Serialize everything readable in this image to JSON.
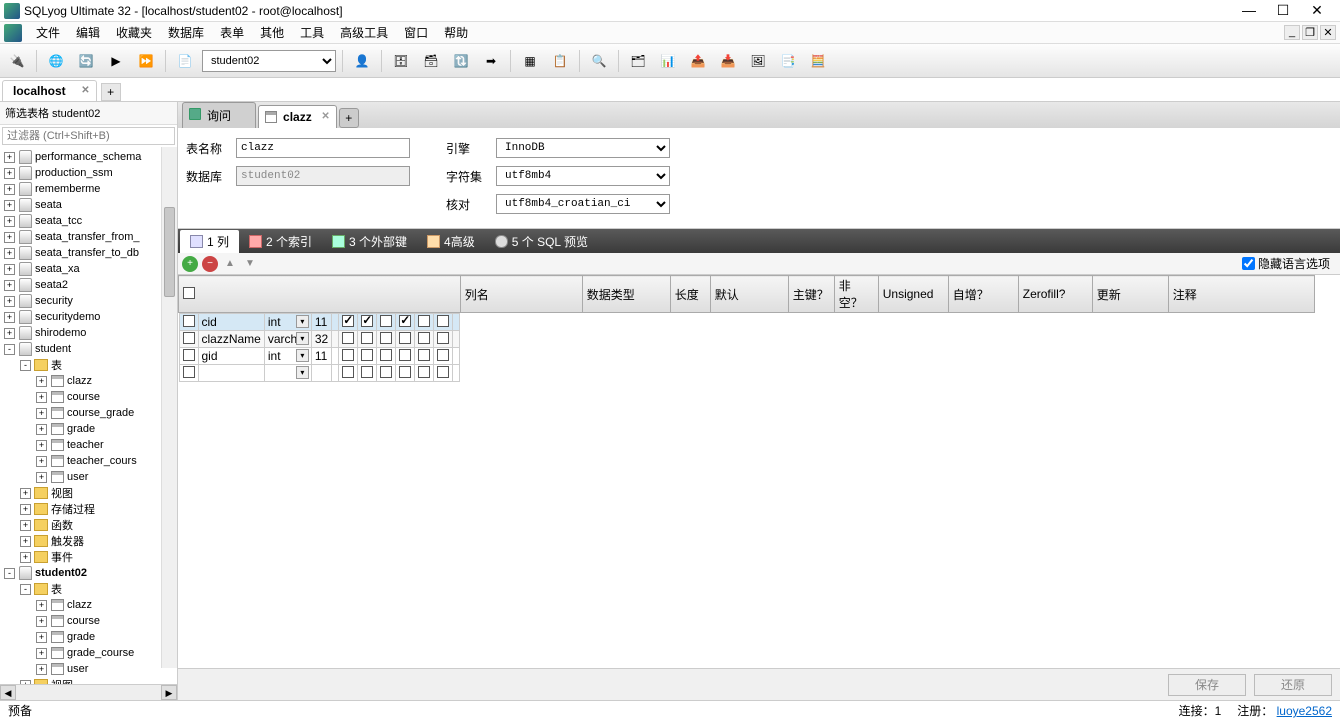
{
  "title": "SQLyog Ultimate 32 - [localhost/student02 - root@localhost]",
  "menu": [
    "文件",
    "编辑",
    "收藏夹",
    "数据库",
    "表单",
    "其他",
    "工具",
    "高级工具",
    "窗口",
    "帮助"
  ],
  "db_dropdown": "student02",
  "conn_tab": "localhost",
  "sidebar": {
    "filter_header": "筛选表格 student02",
    "filter_placeholder": "过滤器 (Ctrl+Shift+B)",
    "items": [
      {
        "indent": 0,
        "toggle": "+",
        "icon": "db",
        "label": "performance_schema"
      },
      {
        "indent": 0,
        "toggle": "+",
        "icon": "db",
        "label": "production_ssm"
      },
      {
        "indent": 0,
        "toggle": "+",
        "icon": "db",
        "label": "rememberme"
      },
      {
        "indent": 0,
        "toggle": "+",
        "icon": "db",
        "label": "seata"
      },
      {
        "indent": 0,
        "toggle": "+",
        "icon": "db",
        "label": "seata_tcc"
      },
      {
        "indent": 0,
        "toggle": "+",
        "icon": "db",
        "label": "seata_transfer_from_"
      },
      {
        "indent": 0,
        "toggle": "+",
        "icon": "db",
        "label": "seata_transfer_to_db"
      },
      {
        "indent": 0,
        "toggle": "+",
        "icon": "db",
        "label": "seata_xa"
      },
      {
        "indent": 0,
        "toggle": "+",
        "icon": "db",
        "label": "seata2"
      },
      {
        "indent": 0,
        "toggle": "+",
        "icon": "db",
        "label": "security"
      },
      {
        "indent": 0,
        "toggle": "+",
        "icon": "db",
        "label": "securitydemo"
      },
      {
        "indent": 0,
        "toggle": "+",
        "icon": "db",
        "label": "shirodemo"
      },
      {
        "indent": 0,
        "toggle": "-",
        "icon": "db",
        "label": "student"
      },
      {
        "indent": 1,
        "toggle": "-",
        "icon": "folder",
        "label": "表"
      },
      {
        "indent": 2,
        "toggle": "+",
        "icon": "table",
        "label": "clazz"
      },
      {
        "indent": 2,
        "toggle": "+",
        "icon": "table",
        "label": "course"
      },
      {
        "indent": 2,
        "toggle": "+",
        "icon": "table",
        "label": "course_grade"
      },
      {
        "indent": 2,
        "toggle": "+",
        "icon": "table",
        "label": "grade"
      },
      {
        "indent": 2,
        "toggle": "+",
        "icon": "table",
        "label": "teacher"
      },
      {
        "indent": 2,
        "toggle": "+",
        "icon": "table",
        "label": "teacher_cours"
      },
      {
        "indent": 2,
        "toggle": "+",
        "icon": "table",
        "label": "user"
      },
      {
        "indent": 1,
        "toggle": "+",
        "icon": "folder",
        "label": "视图"
      },
      {
        "indent": 1,
        "toggle": "+",
        "icon": "folder",
        "label": "存储过程"
      },
      {
        "indent": 1,
        "toggle": "+",
        "icon": "folder",
        "label": "函数"
      },
      {
        "indent": 1,
        "toggle": "+",
        "icon": "folder",
        "label": "触发器"
      },
      {
        "indent": 1,
        "toggle": "+",
        "icon": "folder",
        "label": "事件"
      },
      {
        "indent": 0,
        "toggle": "-",
        "icon": "db",
        "label": "student02",
        "bold": true
      },
      {
        "indent": 1,
        "toggle": "-",
        "icon": "folder",
        "label": "表"
      },
      {
        "indent": 2,
        "toggle": "+",
        "icon": "table",
        "label": "clazz"
      },
      {
        "indent": 2,
        "toggle": "+",
        "icon": "table",
        "label": "course"
      },
      {
        "indent": 2,
        "toggle": "+",
        "icon": "table",
        "label": "grade"
      },
      {
        "indent": 2,
        "toggle": "+",
        "icon": "table",
        "label": "grade_course"
      },
      {
        "indent": 2,
        "toggle": "+",
        "icon": "table",
        "label": "user"
      },
      {
        "indent": 1,
        "toggle": "+",
        "icon": "folder",
        "label": "视图"
      }
    ]
  },
  "content_tabs": {
    "tab1_label": "询问",
    "tab2_label": "clazz"
  },
  "form": {
    "table_name_label": "表名称",
    "table_name_value": "clazz",
    "database_label": "数据库",
    "database_value": "student02",
    "engine_label": "引擎",
    "engine_value": "InnoDB",
    "charset_label": "字符集",
    "charset_value": "utf8mb4",
    "collation_label": "核对",
    "collation_value": "utf8mb4_croatian_ci"
  },
  "sub_tabs": {
    "t1": "1 列",
    "t2": "2 个索引",
    "t3": "3 个外部键",
    "t4": "4高级",
    "t5": "5 个 SQL 预览"
  },
  "hide_lang_label": "隐藏语言选项",
  "grid": {
    "headers": {
      "name": "列名",
      "type": "数据类型",
      "len": "长度",
      "def": "默认",
      "pk": "主键？",
      "nn": "非空？",
      "uns": "Unsigned",
      "ai": "自增？",
      "zf": "Zerofill?",
      "upd": "更新",
      "com": "注释"
    },
    "rows": [
      {
        "name": "cid",
        "type": "int",
        "len": "11",
        "def": "",
        "pk": true,
        "nn": true,
        "uns": false,
        "ai": true,
        "zf": false,
        "upd": false,
        "com": "",
        "sel": true
      },
      {
        "name": "clazzName",
        "type": "varchar",
        "len": "32",
        "def": "",
        "pk": false,
        "nn": false,
        "uns": false,
        "ai": false,
        "zf": false,
        "upd": false,
        "com": ""
      },
      {
        "name": "gid",
        "type": "int",
        "len": "11",
        "def": "",
        "pk": false,
        "nn": false,
        "uns": false,
        "ai": false,
        "zf": false,
        "upd": false,
        "com": ""
      }
    ]
  },
  "buttons": {
    "save": "保存",
    "revert": "还原"
  },
  "status": {
    "ready": "预备",
    "conn": "连接：1",
    "reg_label": "注册：",
    "reg_user": "luoye2562"
  }
}
